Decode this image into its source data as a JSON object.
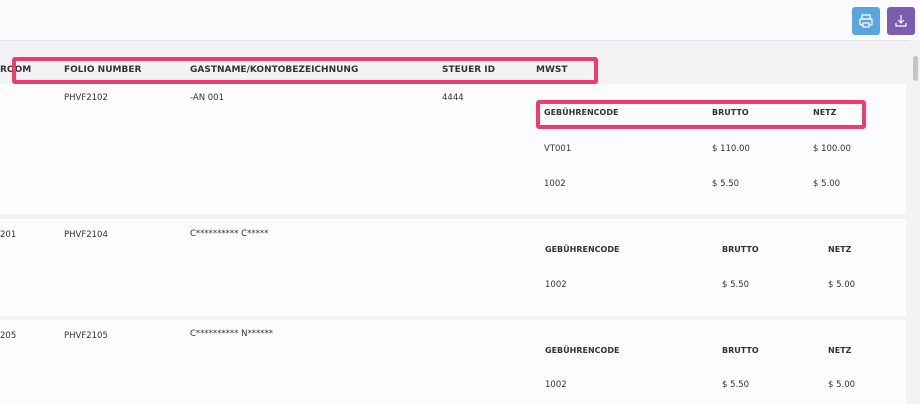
{
  "toolbar": {
    "print_icon": "printer-icon",
    "download_icon": "download-icon"
  },
  "columns": [
    "ROOM",
    "FOLIO NUMBER",
    "GASTNAME/KONTOBEZEICHNUNG",
    "STEUER ID",
    "MWST"
  ],
  "charge_columns": [
    "GEBÜHRENCODE",
    "BRUTTO",
    "NETZ"
  ],
  "records": [
    {
      "room": "",
      "folio": "PHVF2102",
      "guest": "-AN 001",
      "tax_id": "4444",
      "charges": [
        {
          "code": "VT001",
          "brutto": "$ 110.00",
          "netz": "$ 100.00"
        },
        {
          "code": "1002",
          "brutto": "$ 5.50",
          "netz": "$ 5.00"
        }
      ]
    },
    {
      "room": "201",
      "folio": "PHVF2104",
      "guest": "C********** C*****",
      "tax_id": "",
      "charges": [
        {
          "code": "1002",
          "brutto": "$ 5.50",
          "netz": "$ 5.00"
        }
      ]
    },
    {
      "room": "205",
      "folio": "PHVF2105",
      "guest": "C********** N******",
      "tax_id": "",
      "charges": [
        {
          "code": "1002",
          "brutto": "$ 5.50",
          "netz": "$ 5.00"
        }
      ]
    }
  ],
  "colors": {
    "highlight": "#ee3d6c",
    "print_button": "#5aa6dc",
    "download_button": "#7d5bb0"
  }
}
